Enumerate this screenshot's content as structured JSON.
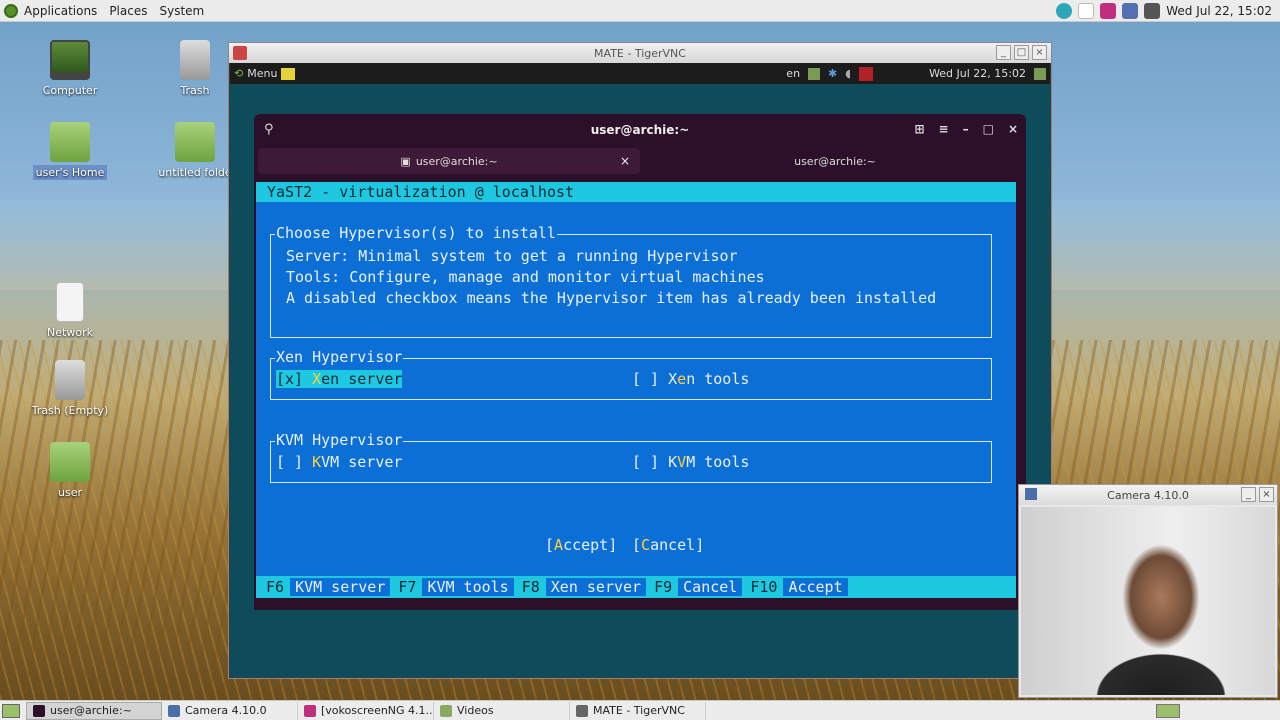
{
  "top_panel": {
    "menus": [
      "Applications",
      "Places",
      "System"
    ],
    "clock": "Wed Jul 22, 15:02"
  },
  "desktop_icons": [
    {
      "label": "Computer"
    },
    {
      "label": "Trash"
    },
    {
      "label": "user's Home"
    },
    {
      "label": "untitled folde"
    },
    {
      "label": "Network"
    },
    {
      "label": "Trash (Empty)"
    },
    {
      "label": "user"
    }
  ],
  "vnc_window": {
    "title": "MATE - TigerVNC",
    "remote_panel": {
      "menu": "Menu",
      "lang": "en",
      "clock": "Wed Jul 22, 15:02"
    }
  },
  "terminal": {
    "title": "user@archie:~",
    "tabs": [
      {
        "label": "user@archie:~"
      },
      {
        "label": "user@archie:~"
      }
    ]
  },
  "yast": {
    "title": "YaST2 - virtualization @ localhost",
    "hypervisor_frame": {
      "legend": "Choose Hypervisor(s) to install",
      "lines": [
        "Server: Minimal system to get a running Hypervisor",
        "Tools: Configure, manage and monitor virtual machines",
        "A disabled checkbox means the Hypervisor item has already been installed"
      ]
    },
    "xen_frame": {
      "legend": "Xen Hypervisor",
      "server": {
        "box": "[x]",
        "hot": "X",
        "rest": "en server"
      },
      "tools": {
        "box": "[ ]",
        "pre": "X",
        "hot": "e",
        "rest": "n tools"
      }
    },
    "kvm_frame": {
      "legend": "KVM Hypervisor",
      "server": {
        "box": "[ ]",
        "hot": "K",
        "rest": "VM server"
      },
      "tools": {
        "box": "[ ]",
        "pre": "K",
        "hot": "V",
        "rest": "M tools"
      }
    },
    "buttons": {
      "accept": {
        "open": "[",
        "hot": "A",
        "rest": "ccept]"
      },
      "cancel": {
        "open": "[",
        "hot": "C",
        "rest": "ancel]"
      }
    },
    "fkeys": [
      {
        "key": "F6",
        "label": "KVM server"
      },
      {
        "key": "F7",
        "label": "KVM tools"
      },
      {
        "key": "F8",
        "label": "Xen server"
      },
      {
        "key": "F9",
        "label": "Cancel"
      },
      {
        "key": "F10",
        "label": "Accept"
      }
    ]
  },
  "camera_window": {
    "title": "Camera 4.10.0"
  },
  "taskbar": {
    "tasks": [
      {
        "label": "user@archie:~",
        "active": true
      },
      {
        "label": "Camera 4.10.0"
      },
      {
        "label": "[vokoscreenNG 4.1..."
      },
      {
        "label": "Videos"
      },
      {
        "label": "MATE - TigerVNC"
      }
    ]
  }
}
